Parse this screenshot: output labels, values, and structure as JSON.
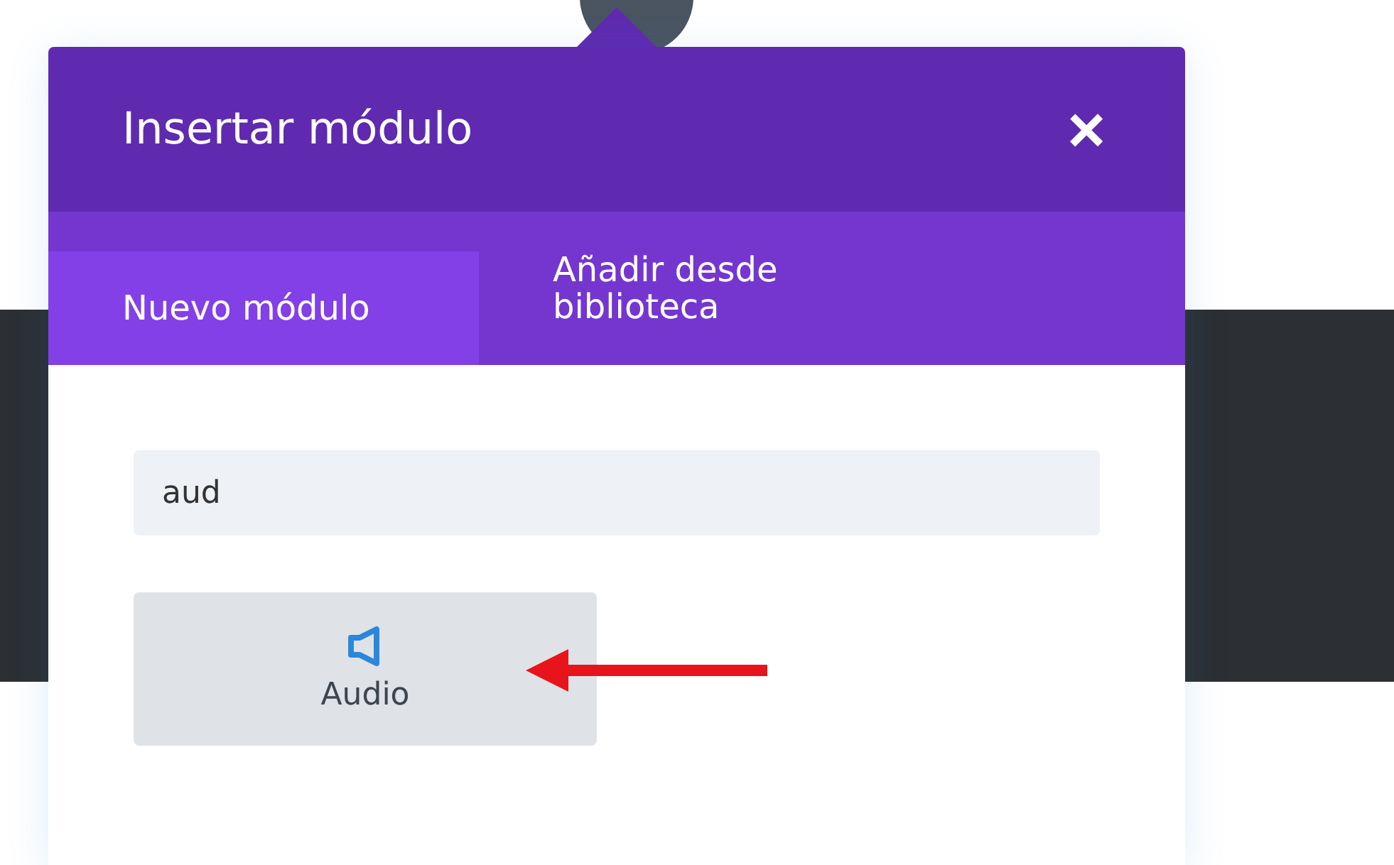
{
  "modal": {
    "title": "Insertar módulo",
    "close": "×"
  },
  "tabs": [
    {
      "label": "Nuevo módulo",
      "selected": true
    },
    {
      "label": "Añadir desde biblioteca",
      "selected": false
    }
  ],
  "search": {
    "value": "aud"
  },
  "modules": [
    {
      "label": "Audio",
      "kind": "audio"
    }
  ]
}
